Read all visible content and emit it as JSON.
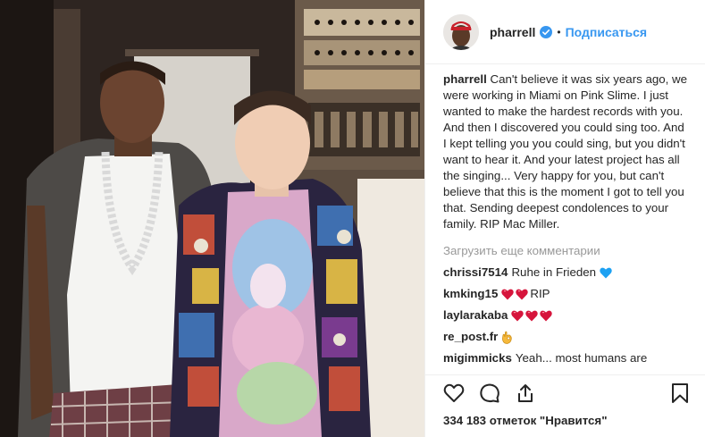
{
  "header": {
    "username": "pharrell",
    "separator": "•",
    "follow_label": "Подписаться"
  },
  "caption": {
    "author": "pharrell",
    "text": "Can't believe it was six years ago, we were working in Miami on Pink Slime. I just wanted to make the hardest records with you. And then I discovered you could sing too. And I kept telling you you could sing, but you didn't want to hear it. And your latest project has all the singing... Very happy for you, but can't believe that this is the moment I got to tell you that. Sending deepest condolences to your family. RIP Mac Miller."
  },
  "load_more_label": "Загрузить еще комментарии",
  "comments": [
    {
      "user": "chrissi7514",
      "text": "Ruhe in Frieden",
      "icon": "blue-heart-icon"
    },
    {
      "user": "kmking15",
      "text": "RIP",
      "icon": "red-heart-icon"
    },
    {
      "user": "laylarakaba",
      "text": "",
      "icon": "red-heart-icon"
    },
    {
      "user": "re_post.fr",
      "text": "",
      "icon": "ok-hand-icon"
    },
    {
      "user": "migimmicks",
      "text": "Yeah... most humans are",
      "icon": ""
    }
  ],
  "likes_text": "334 183 отметок \"Нравится\"",
  "colors": {
    "link_blue": "#3897f0",
    "heart_red": "#e0245e",
    "heart_blue": "#1da1f2",
    "muted": "#999999"
  }
}
